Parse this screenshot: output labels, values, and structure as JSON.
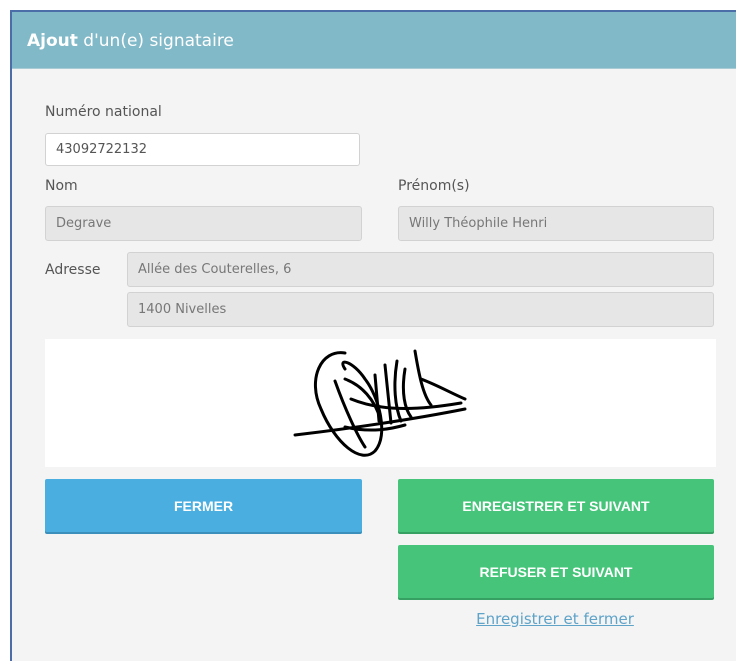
{
  "dialog": {
    "title_bold": "Ajout",
    "title_rest": " d'un(e) signataire"
  },
  "form": {
    "national_number_label": "Numéro national",
    "national_number_value": "43092722132",
    "last_name_label": "Nom",
    "last_name_value": "Degrave",
    "first_name_label": "Prénom(s)",
    "first_name_value": "Willy Théophile Henri",
    "address_label": "Adresse",
    "address_line1": "Allée des Couterelles, 6",
    "address_line2": "1400 Nivelles"
  },
  "buttons": {
    "close": "FERMER",
    "save_next": "ENREGISTRER ET SUIVANT",
    "refuse_next": "REFUSER ET SUIVANT",
    "save_close": "Enregistrer et fermer"
  },
  "colors": {
    "header": "#82b9c8",
    "close_button": "#4aaee0",
    "action_button": "#46c57a",
    "link": "#5fa3c8"
  }
}
